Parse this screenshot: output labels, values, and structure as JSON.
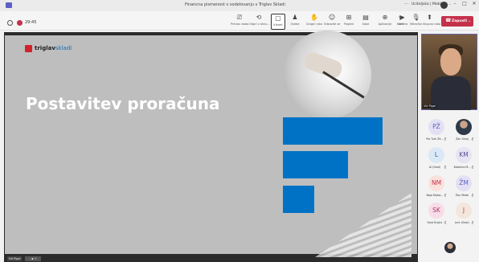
{
  "window": {
    "title": "Financna pismenost v sodelovanju s Triglav Skladi",
    "more": "···",
    "account": "Uciteljska | Meblbox...",
    "controls": {
      "minimize": "–",
      "maximize": "□",
      "close": "✕"
    }
  },
  "meeting": {
    "timer": "29:45",
    "tools": [
      {
        "name": "present",
        "icon": "⎚",
        "label": "Prenos vlada"
      },
      {
        "name": "open",
        "icon": "⟲",
        "label": "Odpri v oknu..."
      },
      {
        "name": "chat",
        "icon": "▢",
        "label": "Klepet"
      },
      {
        "name": "people",
        "icon": "♟",
        "label": "Osebe"
      },
      {
        "name": "raise",
        "icon": "✋",
        "label": "Dvigni roko"
      },
      {
        "name": "react",
        "icon": "☺",
        "label": "Odzovite se"
      },
      {
        "name": "rooms",
        "icon": "⊞",
        "label": "Pogled"
      },
      {
        "name": "view",
        "icon": "▤",
        "label": "Sobe"
      },
      {
        "name": "apps",
        "icon": "⊕",
        "label": "Aplikacije"
      },
      {
        "name": "more",
        "icon": "···",
        "label": "Več"
      },
      {
        "name": "camera",
        "icon": "▶",
        "label": "Kamera"
      },
      {
        "name": "mic",
        "icon": "🎙",
        "label": "Mikrofon"
      },
      {
        "name": "share",
        "icon": "⬆",
        "label": "Skupna raba"
      }
    ],
    "leave": {
      "icon": "☎",
      "label": "Zapusti",
      "dropdown": "⌄"
    }
  },
  "slide": {
    "logo_text_bold": "triglav",
    "logo_text_light": "skladi",
    "title": "Postavitev proračuna",
    "presenter_chip": "Vid Pigal",
    "zoom_chip": "– ▪ +"
  },
  "video": {
    "name": "Vid Pigal"
  },
  "participants": [
    {
      "initials": "PŽ",
      "name": "Pia Turk Že...",
      "bg": "#e3e0f4",
      "fg": "#5b5fc7"
    },
    {
      "initials": "",
      "name": "Žan Smaj",
      "bg": "#2e3a4a",
      "fg": "#ffffff",
      "photo": true
    },
    {
      "initials": "L",
      "name": "Ai (Gost)",
      "bg": "#dbe8f6",
      "fg": "#2f6db5"
    },
    {
      "initials": "KM",
      "name": "Katarina M...",
      "bg": "#e6e3f3",
      "fg": "#5b4a9a"
    },
    {
      "initials": "NM",
      "name": "Naja Maslo...",
      "bg": "#fae1dc",
      "fg": "#c4314b"
    },
    {
      "initials": "ŽM",
      "name": "Žan Mede",
      "bg": "#e3e0f4",
      "fg": "#5b5fc7"
    },
    {
      "initials": "SK",
      "name": "Sara Krajnc",
      "bg": "#f8dce8",
      "fg": "#b0336a"
    },
    {
      "initials": "J",
      "name": "Jure (Gost)",
      "bg": "#f4e6dc",
      "fg": "#a0522d"
    }
  ],
  "mute_icon": "🎙̸"
}
